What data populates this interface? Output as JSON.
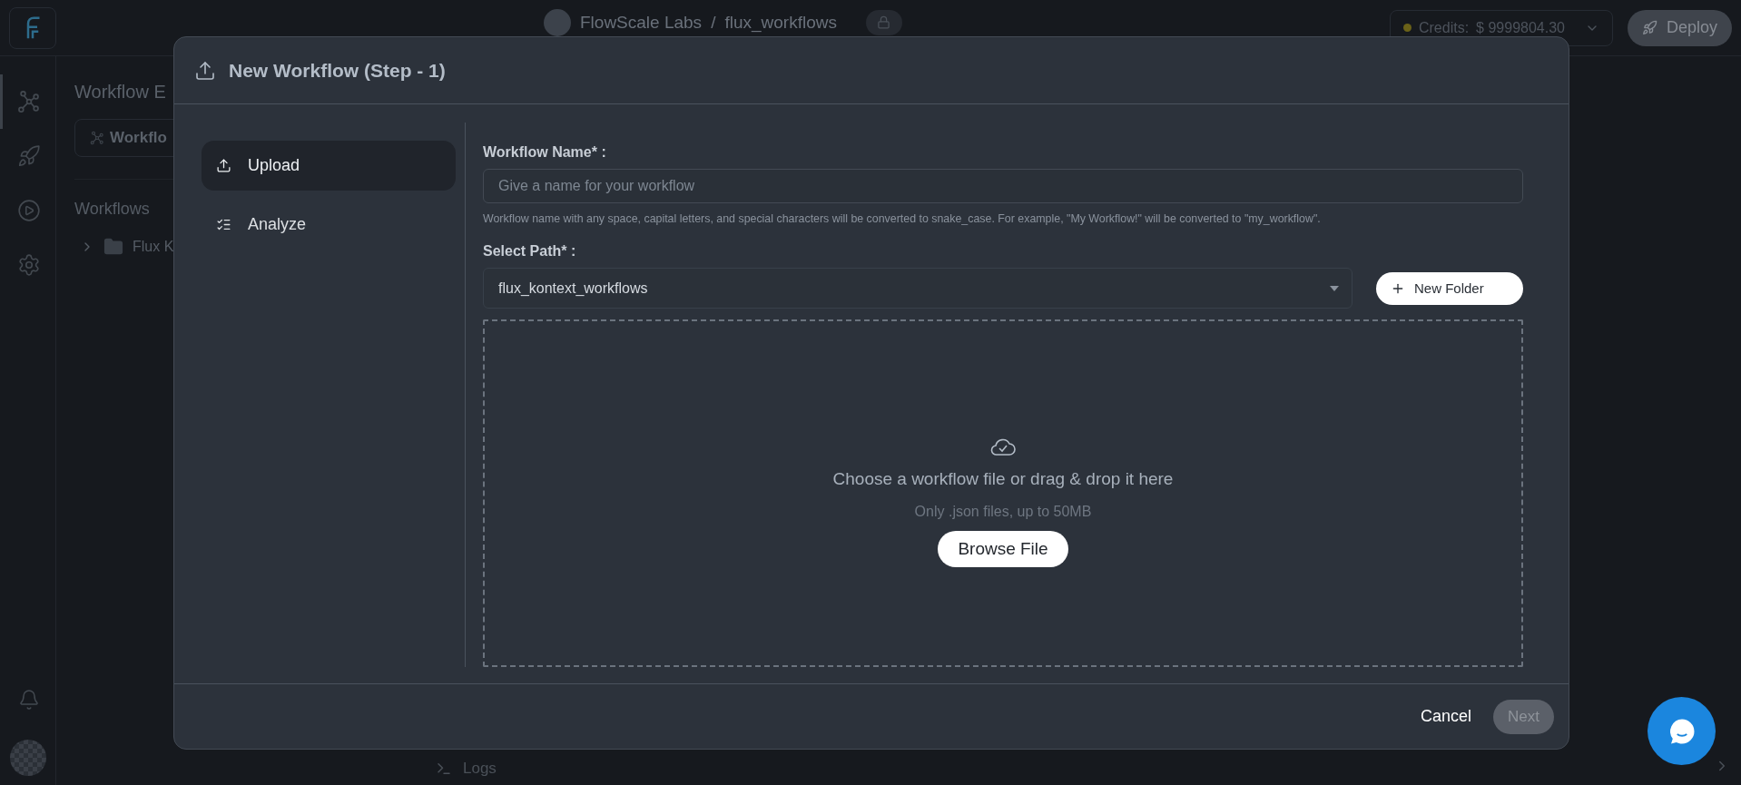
{
  "top_bar": {
    "org": "FlowScale Labs",
    "separator": "/",
    "project": "flux_workflows",
    "credits_label": "Credits:",
    "credits_value": "$ 9999804.30",
    "deploy": "Deploy"
  },
  "rail": {
    "items": [
      {
        "kind": "nodes",
        "selected": true
      },
      {
        "kind": "rocket",
        "selected": false
      },
      {
        "kind": "play",
        "selected": false
      },
      {
        "kind": "settings",
        "selected": false
      }
    ],
    "bottom": [
      {
        "kind": "bell"
      },
      {
        "kind": "avatar"
      }
    ]
  },
  "panel": {
    "title": "Workflow E",
    "tab": "Workflo",
    "section": "Workflows",
    "tree": [
      {
        "label": "Flux K",
        "expanded": false
      }
    ]
  },
  "logs": {
    "label": "Logs"
  },
  "modal": {
    "title": "New Workflow (Step - 1)",
    "steps": [
      {
        "kind": "upload",
        "label": "Upload",
        "selected": true
      },
      {
        "kind": "checklist",
        "label": "Analyze",
        "selected": false
      }
    ],
    "name_field": {
      "label": "Workflow Name* :",
      "placeholder": "Give a name for your workflow",
      "hint": "Workflow name with any space, capital letters, and special characters will be converted to snake_case. For example, \"My Workflow!\" will be converted to \"my_workflow\"."
    },
    "path_field": {
      "label": "Select Path* :",
      "value": "flux_kontext_workflows"
    },
    "new_folder": "New Folder",
    "dropzone": {
      "title": "Choose a workflow file or drag & drop it here",
      "note": "Only .json files, up to 50MB",
      "button": "Browse File"
    },
    "footer": {
      "cancel": {
        "label": "Cancel",
        "disabled": false
      },
      "next": {
        "label": "Next",
        "disabled": true
      }
    }
  }
}
